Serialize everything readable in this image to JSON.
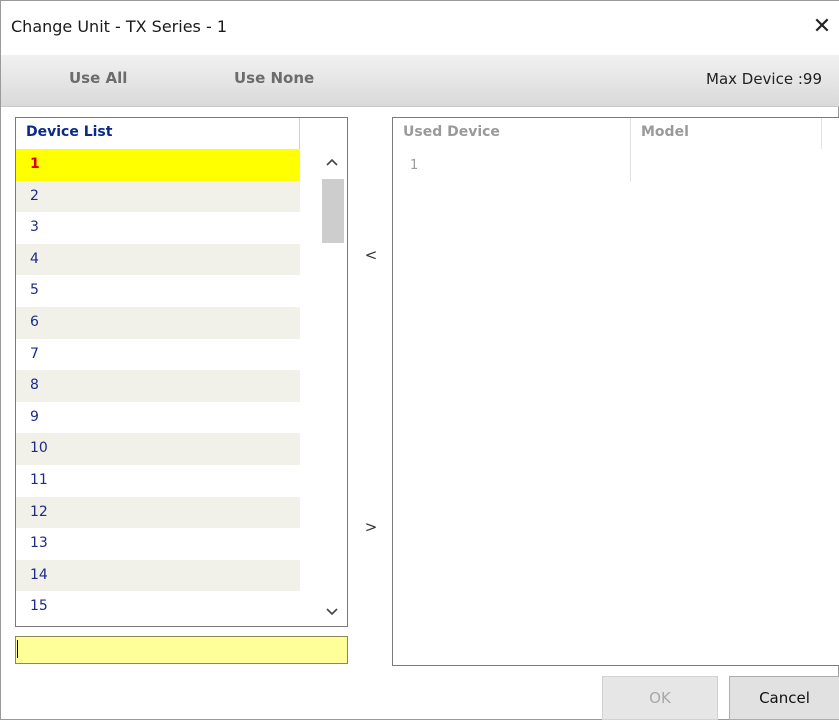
{
  "window": {
    "title": "Change Unit  - TX Series - 1",
    "close_glyph": "✕"
  },
  "toolbar": {
    "use_all": "Use All",
    "use_none": "Use None",
    "max_device": "Max Device :99"
  },
  "device_list": {
    "header": "Device List",
    "selected": "1",
    "items": [
      "1",
      "2",
      "3",
      "4",
      "5",
      "6",
      "7",
      "8",
      "9",
      "10",
      "11",
      "12",
      "13",
      "14",
      "15"
    ]
  },
  "filter_input": {
    "value": ""
  },
  "move_buttons": {
    "left": "<",
    "right": ">"
  },
  "used_devices": {
    "columns": [
      "Used Device",
      "Model"
    ],
    "rows": [
      {
        "device": "1",
        "model": ""
      }
    ]
  },
  "buttons": {
    "ok": "OK",
    "cancel": "Cancel"
  },
  "colors": {
    "selected_bg": "#ffff00",
    "selected_text": "#e00000",
    "list_text": "#1d2a86",
    "filter_bg": "#ffff99"
  }
}
